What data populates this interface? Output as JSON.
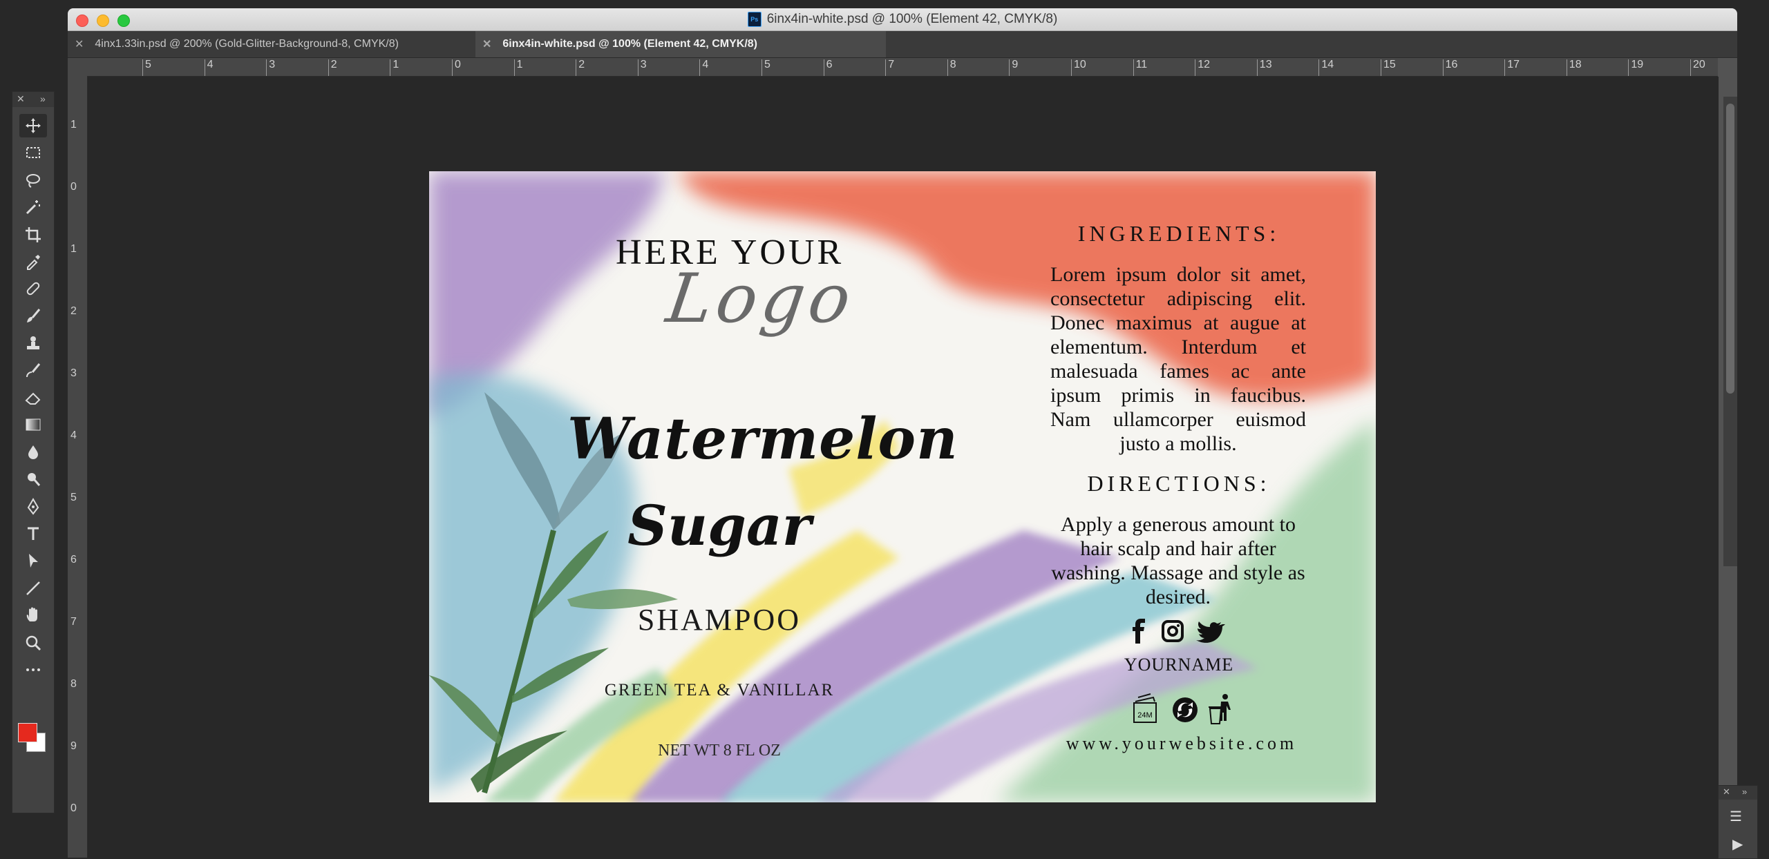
{
  "window": {
    "title": "6inx4in-white.psd @ 100% (Element 42, CMYK/8)",
    "ps_badge": "Ps"
  },
  "tabs": [
    {
      "label": "4inx1.33in.psd @ 200% (Gold-Glitter-Background-8, CMYK/8)",
      "active": false
    },
    {
      "label": "6inx4in-white.psd @ 100% (Element 42, CMYK/8)",
      "active": true
    }
  ],
  "ruler": {
    "h_labels": [
      "5",
      "4",
      "3",
      "2",
      "1",
      "0",
      "1",
      "2",
      "3",
      "4",
      "5",
      "6",
      "7",
      "8",
      "9",
      "10",
      "11",
      "12",
      "13",
      "14",
      "15",
      "16",
      "17",
      "18",
      "19",
      "20"
    ],
    "v_labels": [
      "1",
      "0",
      "1",
      "2",
      "3",
      "4",
      "5",
      "6",
      "7",
      "8",
      "9",
      "0"
    ]
  },
  "tools": [
    {
      "name": "move-tool-icon"
    },
    {
      "name": "marquee-tool-icon"
    },
    {
      "name": "lasso-tool-icon"
    },
    {
      "name": "magic-wand-icon"
    },
    {
      "name": "crop-tool-icon"
    },
    {
      "name": "eyedropper-icon"
    },
    {
      "name": "healing-brush-icon"
    },
    {
      "name": "brush-tool-icon"
    },
    {
      "name": "clone-stamp-icon"
    },
    {
      "name": "history-brush-icon"
    },
    {
      "name": "eraser-icon"
    },
    {
      "name": "gradient-tool-icon"
    },
    {
      "name": "blur-tool-icon"
    },
    {
      "name": "dodge-tool-icon"
    },
    {
      "name": "pen-tool-icon"
    },
    {
      "name": "type-tool-icon"
    },
    {
      "name": "path-selection-icon"
    },
    {
      "name": "line-tool-icon"
    },
    {
      "name": "hand-tool-icon"
    },
    {
      "name": "zoom-tool-icon"
    },
    {
      "name": "more-tools-icon"
    }
  ],
  "colors": {
    "foreground": "#e5291e",
    "background": "#ffffff"
  },
  "label": {
    "logo_line1": "HERE YOUR",
    "logo_line2": "Logo",
    "product_line1": "Watermelon",
    "product_line2": "Sugar",
    "product_type": "SHAMPOO",
    "scent": "GREEN TEA & VANILLAR",
    "net_wt": "NET WT 8 FL OZ",
    "ingredients_heading": "INGREDIENTS:",
    "ingredients_text": "Lorem ipsum dolor sit amet, consectetur adipiscing elit. Donec maximus at augue at elementum. Interdum et malesuada fames ac ante ipsum primis in faucibus. Nam ullamcorper euismod justo a mollis.",
    "directions_heading": "DIRECTIONS:",
    "directions_text": "Apply a generous amount to hair scalp and hair after washing. Massage and style as desired.",
    "your_name": "YOURNAME",
    "website": "www.yourwebsite.com",
    "pao_label": "24M"
  }
}
